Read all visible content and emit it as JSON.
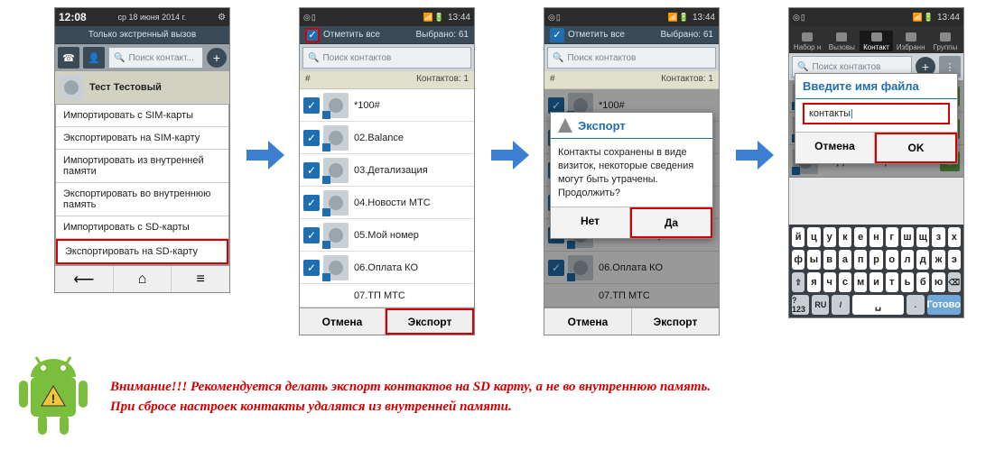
{
  "status": {
    "clock1": "12:08",
    "date1": "ср 18 июня 2014 г.",
    "clock2": "13:44",
    "emerg": "Только экстренный вызов"
  },
  "search": {
    "placeholder1": "Поиск контакт...",
    "placeholder2": "Поиск контактов"
  },
  "header": {
    "markAll": "Отметить все",
    "selected": "Выбрано: 61",
    "contactsCount": "Контактов: 1",
    "hash": "#"
  },
  "tabs": {
    "t1": "Набор н",
    "t2": "Вызовы",
    "t3": "Контакт",
    "t4": "Избранн",
    "t5": "Группы"
  },
  "tester": "Тест Тестовый",
  "menu": {
    "i1": "Импортировать с SIM-карты",
    "i2": "Экспортировать на SIM-карту",
    "i3": "Импортировать из внутренней памяти",
    "i4": "Экспортировать во внутреннюю память",
    "i5": "Импортировать с SD-карты",
    "i6": "Экспортировать на SD-карту"
  },
  "contacts": {
    "c1": "*100#",
    "c2": "02.Balance",
    "c3": "03.Детализация",
    "c4": "04.Новости МТС",
    "c5": "05.Мой номер",
    "c6": "06.Оплата КО",
    "c7": "07.ТП МТС"
  },
  "bottom": {
    "cancel": "Отмена",
    "export": "Экспорт"
  },
  "dialogExport": {
    "title": "Экспорт",
    "body": "Контакты сохранены в виде визиток, некоторые сведения могут быть утрачены. Продолжить?",
    "no": "Нет",
    "yes": "Да"
  },
  "dialogFile": {
    "title": "Введите имя файла",
    "value": "контакты",
    "cancel": "Отмена",
    "ok": "OK"
  },
  "kbd": {
    "r1": [
      "й",
      "ц",
      "у",
      "к",
      "е",
      "н",
      "г",
      "ш",
      "щ",
      "з",
      "х"
    ],
    "r2": [
      "ф",
      "ы",
      "в",
      "а",
      "п",
      "р",
      "о",
      "л",
      "д",
      "ж",
      "э"
    ],
    "r3": [
      "⇧",
      "я",
      "ч",
      "с",
      "м",
      "и",
      "т",
      "ь",
      "б",
      "ю",
      "⌫"
    ],
    "r4": [
      "?123",
      "RU",
      "/",
      "␣",
      ".",
      "Готово"
    ]
  },
  "warn": {
    "l1": "Внимание!!! Рекомендуется делать экспорт контактов на SD карту, а не во внутреннюю память.",
    "l2": "При сбросе настроек контакты удалятся из внутренней памяти."
  }
}
